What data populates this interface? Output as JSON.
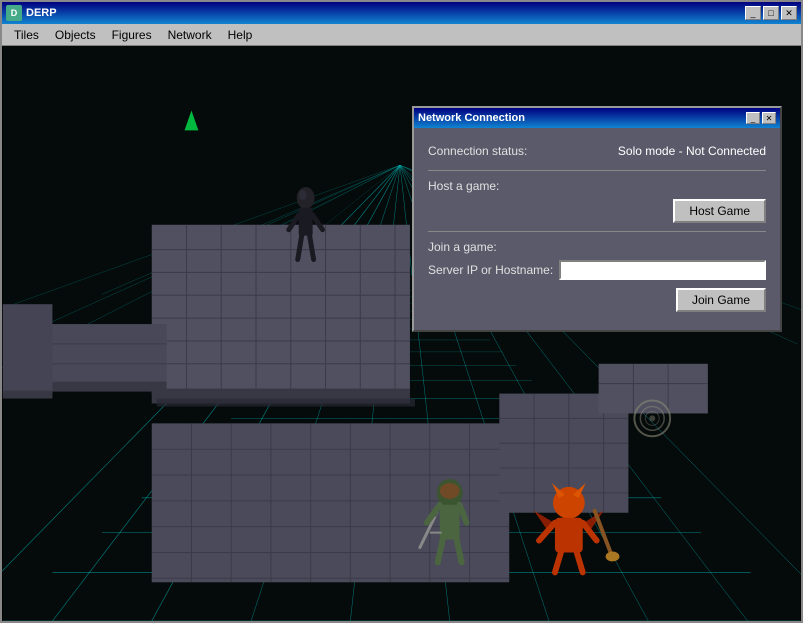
{
  "window": {
    "title": "DERP",
    "icon": "D"
  },
  "titlebar_buttons": {
    "minimize": "_",
    "maximize": "□",
    "close": "✕"
  },
  "menu": {
    "items": [
      {
        "label": "Tiles"
      },
      {
        "label": "Objects"
      },
      {
        "label": "Figures"
      },
      {
        "label": "Network"
      },
      {
        "label": "Help"
      }
    ]
  },
  "dialog": {
    "title": "Network Connection",
    "close_btn": "✕",
    "minimize_btn": "_",
    "connection_status_label": "Connection status:",
    "connection_status_value": "Solo mode - Not Connected",
    "host_section_label": "Host a game:",
    "host_button_label": "Host Game",
    "join_section_label": "Join a game:",
    "server_ip_label": "Server IP or Hostname:",
    "server_ip_placeholder": "",
    "join_button_label": "Join Game"
  },
  "colors": {
    "dialog_bg": "#5a5a6a",
    "grid_color": "#00cccc",
    "bg_color": "#000000"
  }
}
